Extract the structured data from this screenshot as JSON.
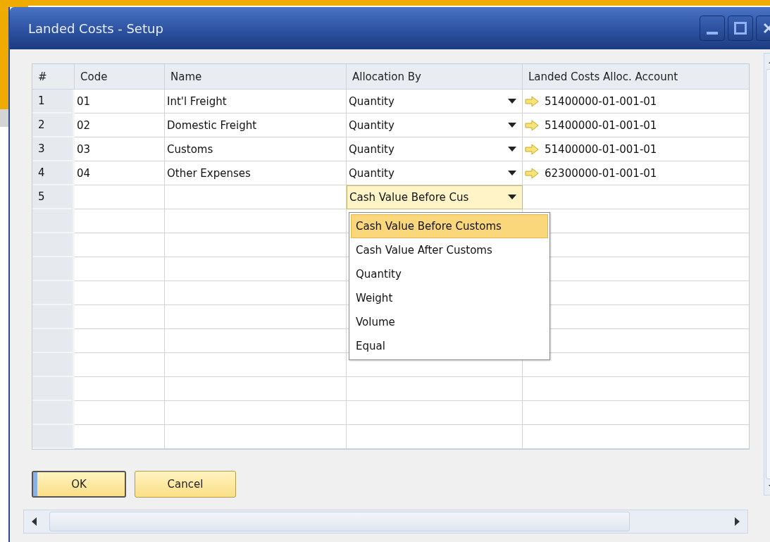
{
  "window": {
    "title": "Landed Costs - Setup"
  },
  "table": {
    "columns": [
      "#",
      "Code",
      "Name",
      "Allocation By",
      "Landed Costs Alloc. Account"
    ],
    "rows": [
      {
        "number": "1",
        "code": "01",
        "name": "Int'l Freight",
        "allocation_by": "Quantity",
        "account": "51400000-01-001-01",
        "editing": false
      },
      {
        "number": "2",
        "code": "02",
        "name": "Domestic Freight",
        "allocation_by": "Quantity",
        "account": "51400000-01-001-01",
        "editing": false
      },
      {
        "number": "3",
        "code": "03",
        "name": "Customs",
        "allocation_by": "Quantity",
        "account": "51400000-01-001-01",
        "editing": false
      },
      {
        "number": "4",
        "code": "04",
        "name": "Other Expenses",
        "allocation_by": "Quantity",
        "account": "62300000-01-001-01",
        "editing": false
      },
      {
        "number": "5",
        "allocation_by": "Cash Value Before Cus",
        "editing": true
      }
    ]
  },
  "dropdown": {
    "options": [
      {
        "label": "Cash Value Before Customs",
        "selected": true
      },
      {
        "label": "Cash Value After Customs",
        "selected": false
      },
      {
        "label": "Quantity",
        "selected": false
      },
      {
        "label": "Weight",
        "selected": false
      },
      {
        "label": "Volume",
        "selected": false
      },
      {
        "label": "Equal",
        "selected": false
      }
    ]
  },
  "buttons": [
    {
      "label": "OK",
      "default": true
    },
    {
      "label": "Cancel",
      "default": false
    }
  ]
}
